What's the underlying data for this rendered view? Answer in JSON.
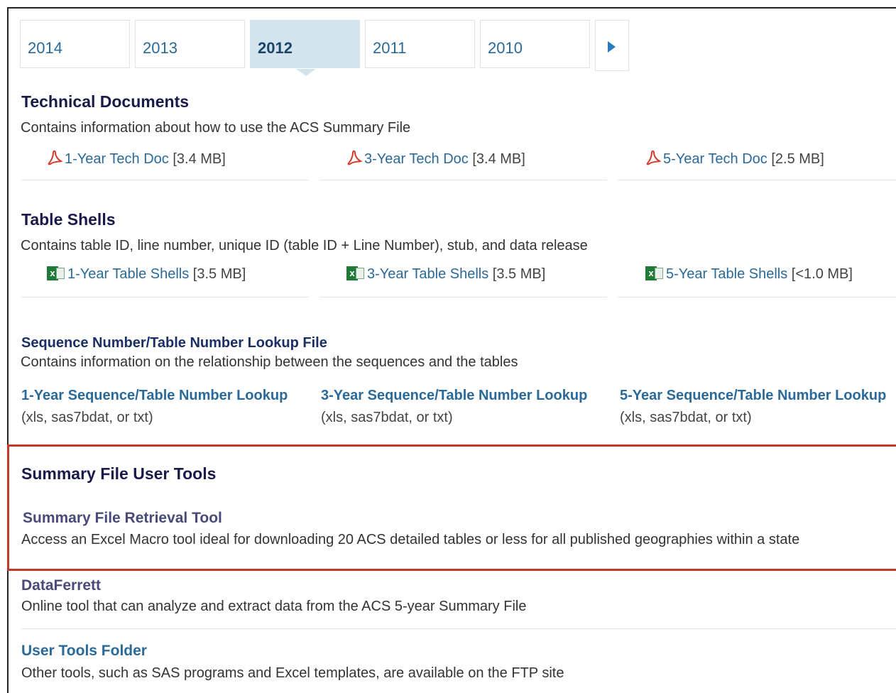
{
  "year_tabs": {
    "items": [
      "2014",
      "2013",
      "2012",
      "2011",
      "2010"
    ],
    "active": "2012"
  },
  "technical_documents": {
    "title": "Technical Documents",
    "description": "Contains information about how to use the ACS Summary File",
    "links": [
      {
        "label": "1-Year Tech Doc",
        "size": "[3.4 MB]",
        "icon": "pdf-icon"
      },
      {
        "label": "3-Year Tech Doc",
        "size": "[3.4 MB]",
        "icon": "pdf-icon"
      },
      {
        "label": "5-Year Tech Doc",
        "size": "[2.5 MB]",
        "icon": "pdf-icon"
      }
    ]
  },
  "table_shells": {
    "title": "Table Shells",
    "description": "Contains table ID, line number, unique ID (table ID + Line Number), stub, and data release",
    "links": [
      {
        "label": "1-Year Table Shells",
        "size": "[3.5 MB]",
        "icon": "excel-icon"
      },
      {
        "label": "3-Year Table Shells",
        "size": "[3.5 MB]",
        "icon": "excel-icon"
      },
      {
        "label": "5-Year Table Shells",
        "size": "[<1.0 MB]",
        "icon": "excel-icon"
      }
    ]
  },
  "lookup_file": {
    "title": "Sequence Number/Table Number Lookup File",
    "description": "Contains information on the relationship between the sequences and the tables",
    "links": [
      {
        "label": "1-Year Sequence/Table Number Lookup",
        "formats": "(xls, sas7bdat, or txt)"
      },
      {
        "label": "3-Year Sequence/Table Number Lookup",
        "formats": "(xls, sas7bdat, or txt)"
      },
      {
        "label": "5-Year Sequence/Table Number Lookup",
        "formats": "(xls, sas7bdat, or txt)"
      }
    ]
  },
  "user_tools": {
    "title": "Summary File User Tools",
    "items": [
      {
        "label": "Summary File Retrieval Tool",
        "description": "Access an Excel Macro tool ideal for downloading 20 ACS detailed tables or less for all published geographies within a state"
      },
      {
        "label": "DataFerrett",
        "description": "Online tool that can analyze and extract data from the ACS 5-year Summary File"
      },
      {
        "label": "User Tools Folder",
        "description": "Other tools, such as SAS programs and Excel templates, are available on the FTP site"
      }
    ]
  },
  "colors": {
    "link": "#2a6a9a",
    "heading": "#1a1a4a",
    "active_tab": "#d3e4ef",
    "highlight_border": "#c0392b"
  }
}
